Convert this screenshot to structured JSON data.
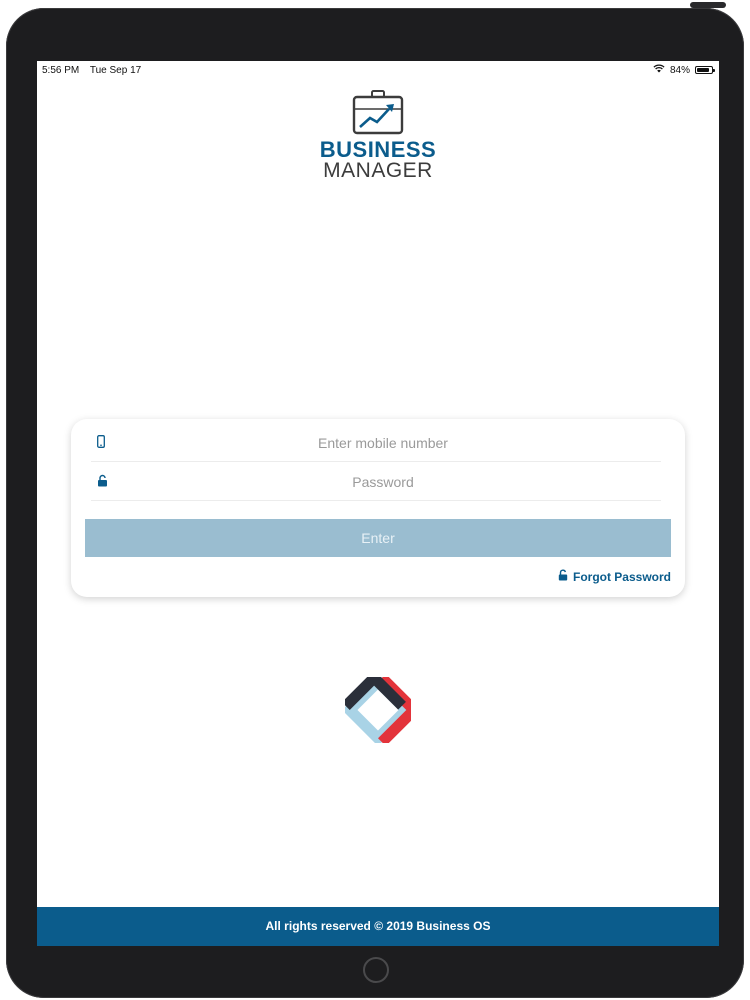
{
  "status_bar": {
    "time": "5:56 PM",
    "date": "Tue Sep 17",
    "battery": "84%",
    "battery_level": 0.84
  },
  "brand": {
    "line1": "BUSINESS",
    "line2": "MANAGER",
    "icon": "briefcase-chart-icon"
  },
  "login": {
    "mobile_placeholder": "Enter mobile number",
    "mobile_value": "",
    "password_placeholder": "Password",
    "password_value": "",
    "enter_label": "Enter",
    "forgot_label": "Forgot Password"
  },
  "footer": {
    "text": "All rights reserved © 2019 Business OS"
  },
  "colors": {
    "brand_blue": "#0b5c8c",
    "button_disabled": "#9abdd0",
    "logo_red": "#e3343b",
    "logo_dark": "#2b2f3a",
    "logo_light_blue": "#a9d3e6"
  }
}
